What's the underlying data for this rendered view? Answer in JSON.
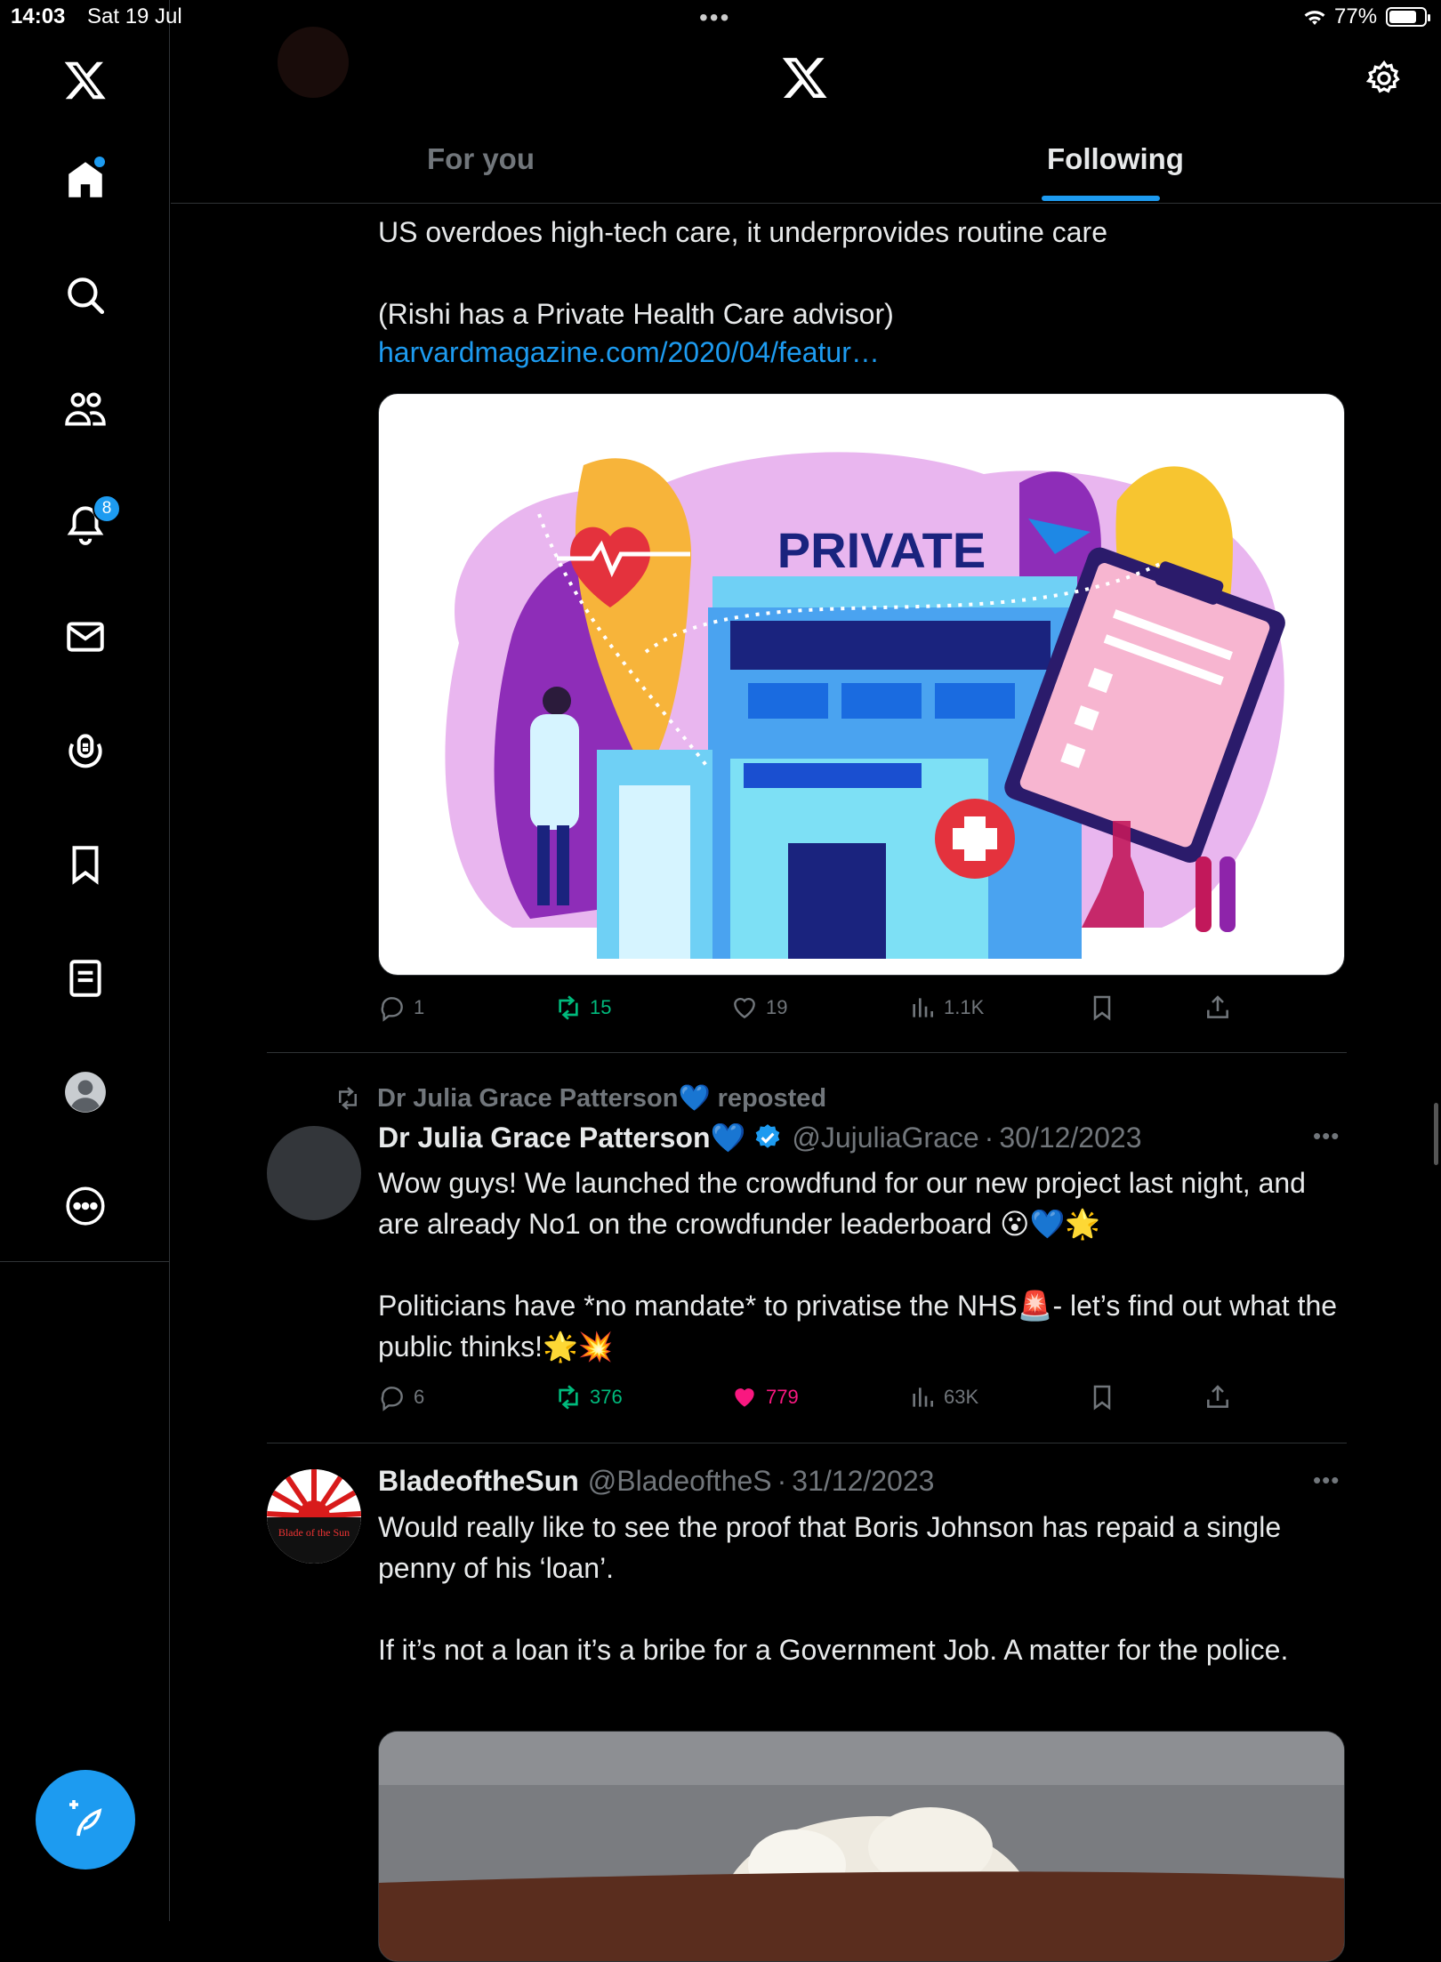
{
  "status_bar": {
    "time": "14:03",
    "date": "Sat 19 Jul",
    "battery": "77%"
  },
  "sidebar": {
    "notifications_badge": "8",
    "items": [
      "x-logo",
      "home-icon",
      "search-icon",
      "communities-icon",
      "bell-icon",
      "mail-icon",
      "grok-icon",
      "bookmark-icon",
      "lists-icon",
      "profile-icon",
      "more-icon"
    ]
  },
  "tabs": {
    "for_you": "For you",
    "following": "Following"
  },
  "tweets": [
    {
      "text_line1": "US overdoes high-tech care, it underprovides routine care",
      "text_line2": "(Rishi has a Private Health Care advisor)",
      "link": "harvardmagazine.com/2020/04/featur…",
      "image_title": "PRIVATE",
      "replies": "1",
      "reposts": "15",
      "likes": "19",
      "views": "1.1K"
    },
    {
      "repost_label": "Dr Julia Grace Patterson💙 reposted",
      "name": "Dr Julia Grace Patterson💙",
      "handle": "@JujuliaGrace",
      "date": "30/12/2023",
      "para1": "Wow guys! We launched the crowdfund for our new project last night, and are already No1 on the crowdfunder leaderboard 😮💙🌟",
      "para2": "Politicians have *no mandate* to privatise the NHS🚨- let’s find out what the public thinks!🌟💥",
      "replies": "6",
      "reposts": "376",
      "likes": "779",
      "views": "63K"
    },
    {
      "name": "BladeoftheSun",
      "handle": "@BladeoftheS",
      "date": "31/12/2023",
      "avatar_text": "Blade of the Sun",
      "para1": "Would really like to see the proof that Boris Johnson has repaid a single penny of his ‘loan’.",
      "para2": "If it’s not a loan it’s a bribe for a Government Job. A matter for the police."
    }
  ],
  "colors": {
    "accent": "#1d9bf0",
    "repost_green": "#00ba7c",
    "like_pink": "#f91880",
    "muted": "#71767b"
  }
}
